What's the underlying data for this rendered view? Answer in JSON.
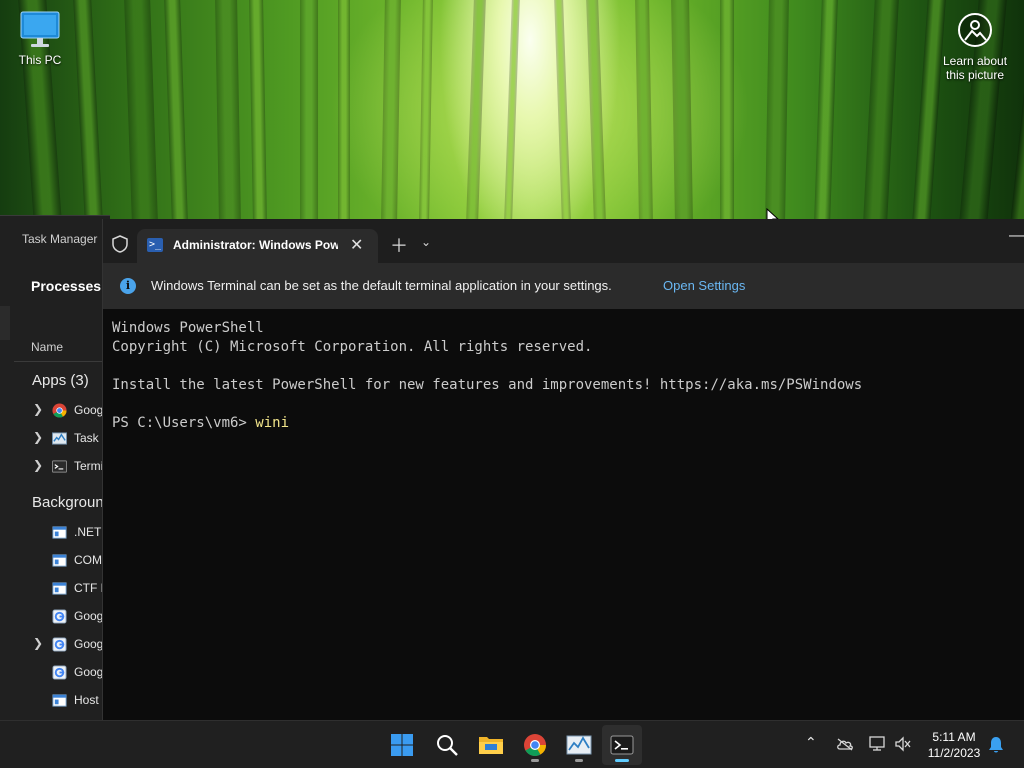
{
  "desktop": {
    "icons": [
      {
        "label": "This PC",
        "icon": "monitor-icon"
      }
    ],
    "spotlight": {
      "label_line1": "Learn about",
      "label_line2": "this picture",
      "icon": "camera-icon"
    }
  },
  "task_manager": {
    "title": "Task Manager",
    "nav_selected": "Processes",
    "column_header": "Name",
    "apps_section": "Apps (3)",
    "apps": [
      {
        "label": "Goog",
        "icon": "chrome-icon",
        "expandable": true
      },
      {
        "label": "Task I",
        "icon": "task-manager-icon",
        "expandable": true
      },
      {
        "label": "Termi",
        "icon": "terminal-icon",
        "expandable": true
      }
    ],
    "background_section": "Backgroun",
    "background": [
      {
        "label": ".NET",
        "icon": "service-icon",
        "expandable": false
      },
      {
        "label": "COM",
        "icon": "service-icon",
        "expandable": false
      },
      {
        "label": "CTF L",
        "icon": "service-icon",
        "expandable": false
      },
      {
        "label": "Goog",
        "icon": "google-updater-icon",
        "expandable": false
      },
      {
        "label": "Goog",
        "icon": "google-updater-icon",
        "expandable": true
      },
      {
        "label": "Goog",
        "icon": "google-updater-icon",
        "expandable": false
      },
      {
        "label": "Host",
        "icon": "service-icon",
        "expandable": false
      }
    ]
  },
  "terminal": {
    "tab_title": "Administrator: Windows PowerShell",
    "infobar": {
      "message": "Windows Terminal can be set as the default terminal application in your settings.",
      "link": "Open Settings"
    },
    "console_lines": [
      "Windows PowerShell",
      "Copyright (C) Microsoft Corporation. All rights reserved.",
      "",
      "Install the latest PowerShell for new features and improvements! https://aka.ms/PSWindows",
      ""
    ],
    "prompt": "PS C:\\Users\\vm6> ",
    "typed": "wini"
  },
  "taskbar": {
    "apps": [
      {
        "name": "start-button",
        "icon": "windows-logo-icon",
        "running": false,
        "active": false
      },
      {
        "name": "search-button",
        "icon": "search-icon",
        "running": false,
        "active": false
      },
      {
        "name": "file-explorer-button",
        "icon": "folder-icon",
        "running": false,
        "active": false
      },
      {
        "name": "chrome-button",
        "icon": "chrome-icon",
        "running": true,
        "active": false
      },
      {
        "name": "task-manager-button",
        "icon": "task-manager-icon",
        "running": true,
        "active": false
      },
      {
        "name": "terminal-button",
        "icon": "terminal-icon",
        "running": true,
        "active": true
      }
    ],
    "tray": [
      "chevron-up-icon",
      "onedrive-icon",
      "network-icon",
      "volume-muted-icon"
    ],
    "clock": {
      "time": "5:11 AM",
      "date": "11/2/2023"
    },
    "notification_icon": "bell-icon"
  },
  "colors": {
    "accent": "#60cdff",
    "link": "#6ab7f2",
    "typed_command": "#f2e58b"
  }
}
